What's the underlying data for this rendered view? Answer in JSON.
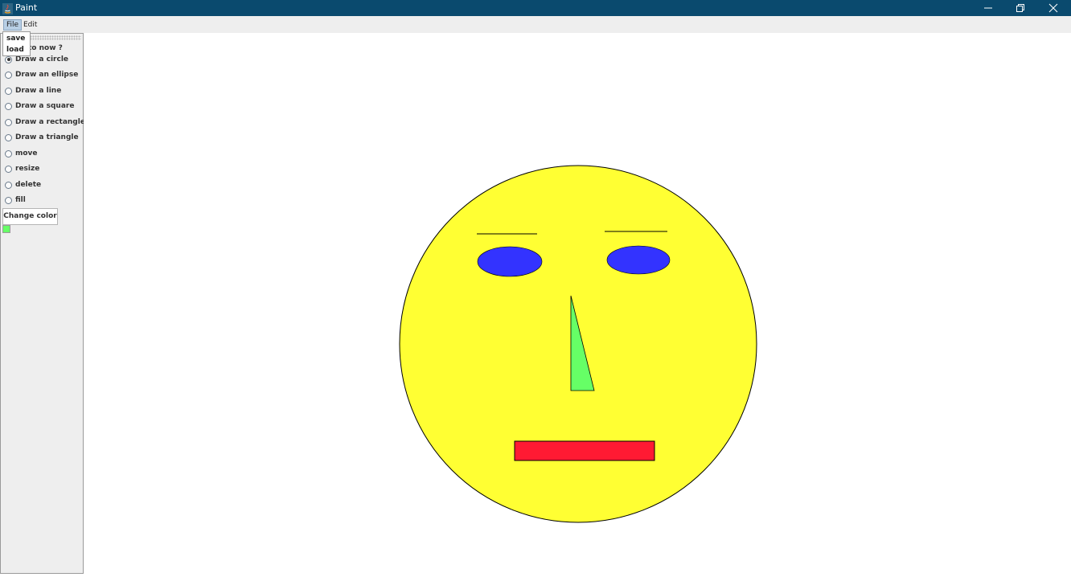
{
  "window": {
    "title": "Paint",
    "controls": [
      "minimize",
      "restore",
      "close"
    ]
  },
  "menubar": {
    "items": [
      "File",
      "Edit"
    ],
    "active": "File"
  },
  "file_menu": {
    "items": [
      "save",
      "load"
    ]
  },
  "panel": {
    "question": "to now ?",
    "tools": [
      {
        "label": "Draw a circle",
        "checked": true
      },
      {
        "label": "Draw an ellipse",
        "checked": false
      },
      {
        "label": "Draw a line",
        "checked": false
      },
      {
        "label": "Draw a square",
        "checked": false
      },
      {
        "label": "Draw a rectangle",
        "checked": false
      },
      {
        "label": "Draw a triangle",
        "checked": false
      },
      {
        "label": "move",
        "checked": false
      },
      {
        "label": "resize",
        "checked": false
      },
      {
        "label": "delete",
        "checked": false
      },
      {
        "label": "fill",
        "checked": false
      }
    ],
    "change_color_label": "Change color",
    "current_color": "#66ff66"
  },
  "colors": {
    "titlebar": "#0a4a6e",
    "face": "#ffff33",
    "eyes": "#3333ff",
    "nose": "#66ff66",
    "mouth": "#ff1a33",
    "outline": "#000000"
  }
}
